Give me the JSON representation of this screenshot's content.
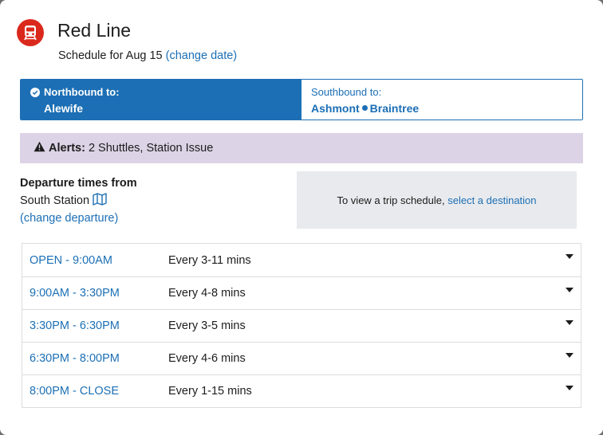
{
  "header": {
    "route_name": "Red Line",
    "schedule_prefix": "Schedule for Aug 15",
    "change_date": "(change date)"
  },
  "direction": {
    "northbound_label": "Northbound to:",
    "northbound_dest": "Alewife",
    "southbound_label": "Southbound to:",
    "southbound_dest_1": "Ashmont",
    "southbound_dest_2": "Braintree"
  },
  "alerts": {
    "label": "Alerts:",
    "text": "2 Shuttles, Station Issue"
  },
  "departure": {
    "heading": "Departure times from",
    "station": "South Station",
    "change": "(change departure)"
  },
  "trip_box": {
    "text": "To view a trip schedule,",
    "link": "select a destination"
  },
  "times": [
    {
      "range": "OPEN - 9:00AM",
      "freq": "Every 3-11 mins"
    },
    {
      "range": "9:00AM - 3:30PM",
      "freq": "Every 4-8 mins"
    },
    {
      "range": "3:30PM - 6:30PM",
      "freq": "Every 3-5 mins"
    },
    {
      "range": "6:30PM - 8:00PM",
      "freq": "Every 4-6 mins"
    },
    {
      "range": "8:00PM - CLOSE",
      "freq": "Every 1-15 mins"
    }
  ],
  "colors": {
    "red_line": "#da291c",
    "link_blue": "#1c6fb5",
    "alert_bg": "#dcd3e6",
    "trip_box_bg": "#e9eaed"
  }
}
